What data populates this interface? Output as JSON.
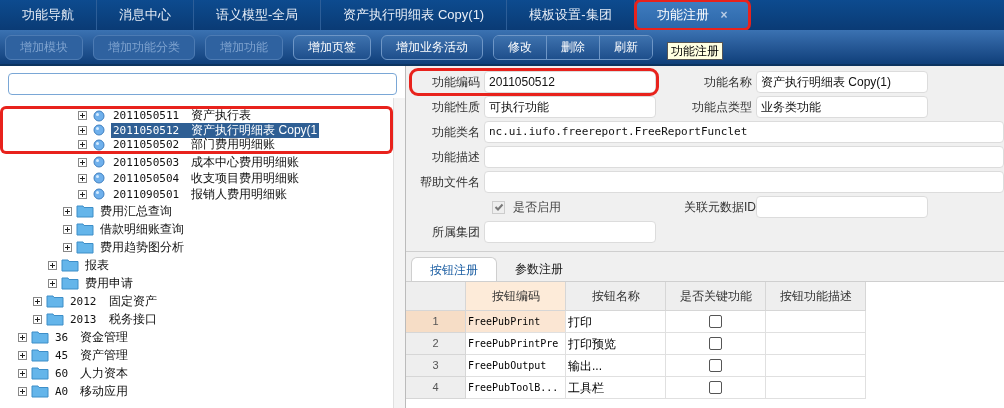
{
  "tabs": [
    {
      "label": "功能导航",
      "selected": false,
      "marked": false
    },
    {
      "label": "消息中心",
      "selected": false,
      "marked": false
    },
    {
      "label": "语义模型-全局",
      "selected": false,
      "marked": false
    },
    {
      "label": "资产执行明细表 Copy(1)",
      "selected": false,
      "marked": false
    },
    {
      "label": "模板设置-集团",
      "selected": false,
      "marked": false
    },
    {
      "label": "功能注册",
      "selected": true,
      "marked": true,
      "close": "×"
    }
  ],
  "toolbar": {
    "buttons": [
      {
        "label": "增加模块",
        "disabled": true
      },
      {
        "label": "增加功能分类",
        "disabled": true
      },
      {
        "label": "增加功能",
        "disabled": true
      },
      {
        "label": "增加页签",
        "disabled": false
      },
      {
        "label": "增加业务活动",
        "disabled": false
      }
    ],
    "group": [
      {
        "label": "修改"
      },
      {
        "label": "删除"
      },
      {
        "label": "刷新"
      }
    ],
    "tooltip": "功能注册"
  },
  "tree": [
    {
      "kind": "group",
      "children": [
        {
          "kind": "group",
          "children": [
            {
              "kind": "group",
              "children": [
                {
                  "kind": "group",
                  "children": [
                    {
                      "kind": "function",
                      "code": "2011050511",
                      "label": "资产执行表",
                      "expanded": false,
                      "selected": false,
                      "marked": true
                    },
                    {
                      "kind": "function",
                      "code": "2011050512",
                      "label": "资产执行明细表 Copy(1",
                      "expanded": false,
                      "selected": true,
                      "marked": true
                    },
                    {
                      "kind": "function",
                      "code": "2011050502",
                      "label": "部门费用明细账",
                      "expanded": false,
                      "selected": false,
                      "marked": true
                    },
                    {
                      "kind": "function",
                      "code": "2011050503",
                      "label": "成本中心费用明细账",
                      "expanded": false,
                      "selected": false,
                      "marked": false
                    },
                    {
                      "kind": "function",
                      "code": "2011050504",
                      "label": "收支项目费用明细账",
                      "expanded": false,
                      "selected": false,
                      "marked": false
                    },
                    {
                      "kind": "function",
                      "code": "2011090501",
                      "label": "报销人费用明细账",
                      "expanded": false,
                      "selected": false,
                      "marked": false
                    }
                  ]
                },
                {
                  "kind": "folder",
                  "label": "费用汇总查询",
                  "expanded": false,
                  "selected": false,
                  "marked": false
                },
                {
                  "kind": "folder",
                  "label": "借款明细账查询",
                  "expanded": false,
                  "selected": false,
                  "marked": false
                },
                {
                  "kind": "folder",
                  "label": "费用趋势图分析",
                  "expanded": false,
                  "selected": false,
                  "marked": false
                }
              ]
            },
            {
              "kind": "folder",
              "label": "报表",
              "expanded": false,
              "selected": false,
              "marked": false
            },
            {
              "kind": "folder",
              "label": "费用申请",
              "expanded": false,
              "selected": false,
              "marked": false
            }
          ]
        },
        {
          "kind": "folder",
          "code": "2012",
          "label": "固定资产",
          "expanded": false,
          "selected": false,
          "marked": false
        },
        {
          "kind": "folder",
          "code": "2013",
          "label": "税务接口",
          "expanded": false,
          "selected": false,
          "marked": false
        }
      ]
    },
    {
      "kind": "folder",
      "code": "36",
      "label": "资金管理",
      "expanded": false,
      "selected": false,
      "marked": false
    },
    {
      "kind": "folder",
      "code": "45",
      "label": "资产管理",
      "expanded": false,
      "selected": false,
      "marked": false
    },
    {
      "kind": "folder",
      "code": "60",
      "label": "人力资本",
      "expanded": false,
      "selected": false,
      "marked": false
    },
    {
      "kind": "folder",
      "code": "A0",
      "label": "移动应用",
      "expanded": false,
      "selected": false,
      "marked": false
    }
  ],
  "form": {
    "rows": [
      [
        {
          "kind": "text",
          "label": "功能编码",
          "value": "2011050512",
          "marked": true
        },
        {
          "kind": "text",
          "label": "功能名称",
          "value": "资产执行明细表 Copy(1)",
          "marked": false
        }
      ],
      [
        {
          "kind": "text",
          "label": "功能性质",
          "value": "可执行功能",
          "marked": false
        },
        {
          "kind": "text",
          "label": "功能点类型",
          "value": "业务类功能",
          "marked": false
        }
      ],
      [
        {
          "kind": "wide",
          "label": "功能类名",
          "value": "nc.ui.iufo.freereport.FreeReportFunclet",
          "marked": false
        }
      ],
      [
        {
          "kind": "wide",
          "label": "功能描述",
          "marked": false
        }
      ],
      [
        {
          "kind": "wide",
          "label": "帮助文件名",
          "marked": false
        }
      ],
      [
        {
          "kind": "checkbox",
          "label": "是否启用",
          "checked": true,
          "disabled": true,
          "marked": false
        },
        {
          "kind": "text",
          "label": "关联元数据ID",
          "marked": false
        }
      ],
      [
        {
          "kind": "text",
          "label": "所属集团",
          "marked": false
        }
      ]
    ]
  },
  "subtabs": [
    {
      "label": "按钮注册",
      "selected": true
    },
    {
      "label": "参数注册",
      "selected": false
    }
  ],
  "table": {
    "columns": [
      {
        "label": "按钮编码",
        "selected": true
      },
      {
        "label": "按钮名称",
        "selected": false
      },
      {
        "label": "是否关键功能",
        "selected": false
      },
      {
        "label": "按钮功能描述",
        "selected": false
      }
    ],
    "rows": [
      {
        "number": "1",
        "code": "FreePubPrint",
        "name": "打印",
        "key": false,
        "selected": true
      },
      {
        "number": "2",
        "code": "FreePubPrintPre",
        "name": "打印预览",
        "key": false,
        "selected": false
      },
      {
        "number": "3",
        "code": "FreePubOutput",
        "name": "输出...",
        "key": false,
        "selected": false
      },
      {
        "number": "4",
        "code": "FreePubToolB...",
        "name": "工具栏",
        "key": false,
        "selected": false
      }
    ]
  }
}
